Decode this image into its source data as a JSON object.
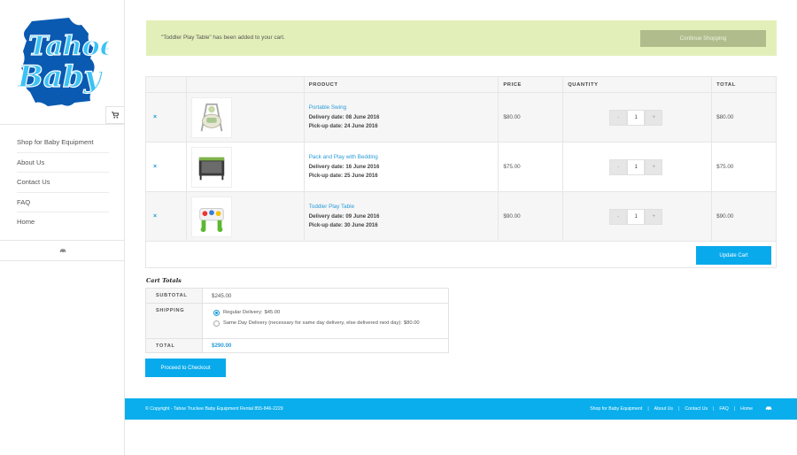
{
  "brand": {
    "logo_line1": "Tahoe",
    "logo_line2": "Baby",
    "logo_color": "#0a5ab2",
    "logo_text_color": "#3cc2f3"
  },
  "sidebar": {
    "cart_icon": "shopping-cart-icon",
    "items": [
      {
        "label": "Shop for Baby Equipment"
      },
      {
        "label": "About Us"
      },
      {
        "label": "Contact Us"
      },
      {
        "label": "FAQ"
      },
      {
        "label": "Home"
      }
    ],
    "bottom_icon": "car-icon"
  },
  "notice": {
    "message": "\"Toddler Play Table\" has been added to your cart.",
    "continue_label": "Continue Shopping",
    "bg_color": "#e3efb9"
  },
  "cart": {
    "headers": {
      "product": "PRODUCT",
      "price": "PRICE",
      "quantity": "QUANTITY",
      "total": "TOTAL"
    },
    "remove_symbol": "×",
    "minus": "-",
    "plus": "+",
    "items": [
      {
        "name": "Portable Swing",
        "delivery": "Delivery date: 08 June 2016",
        "pickup": "Pick-up date: 24 June 2016",
        "price": "$80.00",
        "qty": "1",
        "total": "$80.00"
      },
      {
        "name": "Pack and Play with Bedding",
        "delivery": "Delivery date: 16 June 2016",
        "pickup": "Pick-up date: 25 June 2016",
        "price": "$75.00",
        "qty": "1",
        "total": "$75.00"
      },
      {
        "name": "Toddler Play Table",
        "delivery": "Delivery date: 09 June 2016",
        "pickup": "Pick-up date: 30 June 2016",
        "price": "$90.00",
        "qty": "1",
        "total": "$90.00"
      }
    ],
    "update_label": "Update Cart"
  },
  "totals": {
    "title": "Cart Totals",
    "subtotal_label": "SUBTOTAL",
    "subtotal_value": "$245.00",
    "shipping_label": "SHIPPING",
    "option1_text": "Regular Delivery: ",
    "option1_price": "$45.00",
    "option2_text": "Same Day Delivery (necessary for same day delivery, else delivered next day): ",
    "option2_price": "$80.00",
    "total_label": "TOTAL",
    "total_value": "$290.00",
    "checkout_label": "Proceed to Checkout"
  },
  "footer": {
    "copyright": "© Copyright - Tahoe Truckee Baby Equipment Rental 855-846-2229",
    "links": [
      {
        "label": "Shop for Baby Equipment"
      },
      {
        "label": "About Us"
      },
      {
        "label": "Contact Us"
      },
      {
        "label": "FAQ"
      },
      {
        "label": "Home"
      }
    ],
    "separator": "|",
    "icon": "car-icon"
  },
  "colors": {
    "accent": "#09aaec",
    "link": "#2a9bd8",
    "footer_bg": "#0aaeec"
  }
}
